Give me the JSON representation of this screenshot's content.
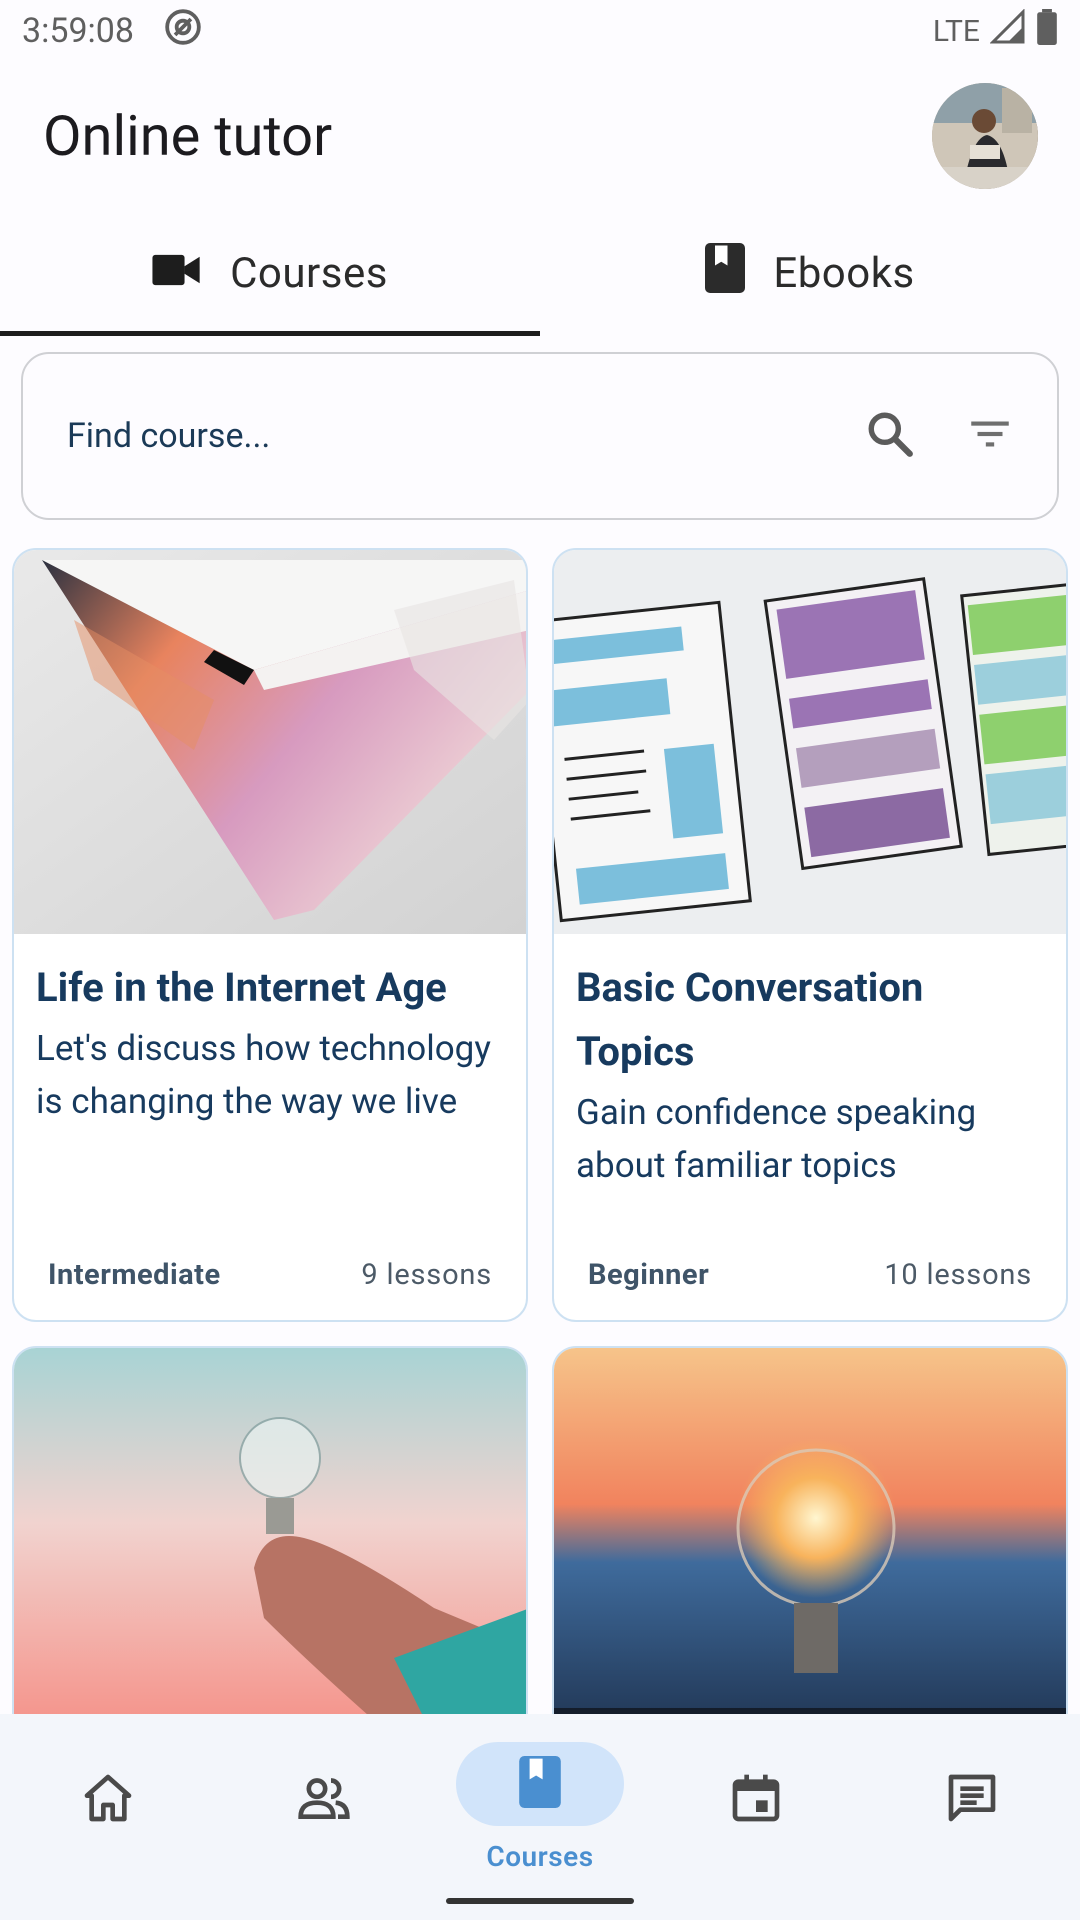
{
  "status": {
    "time": "3:59:08",
    "network": "LTE"
  },
  "app": {
    "title": "Online tutor"
  },
  "tabs": [
    {
      "label": "Courses",
      "icon": "video-camera-icon",
      "active": true
    },
    {
      "label": "Ebooks",
      "icon": "book-icon",
      "active": false
    }
  ],
  "search": {
    "placeholder": "Find course..."
  },
  "courses": [
    {
      "title": "Life in the Internet Age",
      "description": "Let's discuss how technology is changing the way we live",
      "level": "Intermediate",
      "lessons": "9 lessons",
      "image": "laptop-image"
    },
    {
      "title": "Basic Conversation Topics",
      "description": "Gain confidence speaking about familiar topics",
      "level": "Beginner",
      "lessons": "10 lessons",
      "image": "wireframe-sketch-image"
    },
    {
      "image": "hand-holding-lightbulb-image"
    },
    {
      "image": "lightbulb-sunset-image"
    }
  ],
  "bottom_nav": [
    {
      "icon": "home-icon",
      "label": "",
      "active": false
    },
    {
      "icon": "people-icon",
      "label": "",
      "active": false
    },
    {
      "icon": "book-icon",
      "label": "Courses",
      "active": true
    },
    {
      "icon": "calendar-icon",
      "label": "",
      "active": false
    },
    {
      "icon": "message-icon",
      "label": "",
      "active": false
    }
  ],
  "colors": {
    "accent": "#4a8fd0",
    "pill": "#d1e4fa",
    "card_border": "#cde1f2",
    "text_primary": "#173a5e"
  }
}
